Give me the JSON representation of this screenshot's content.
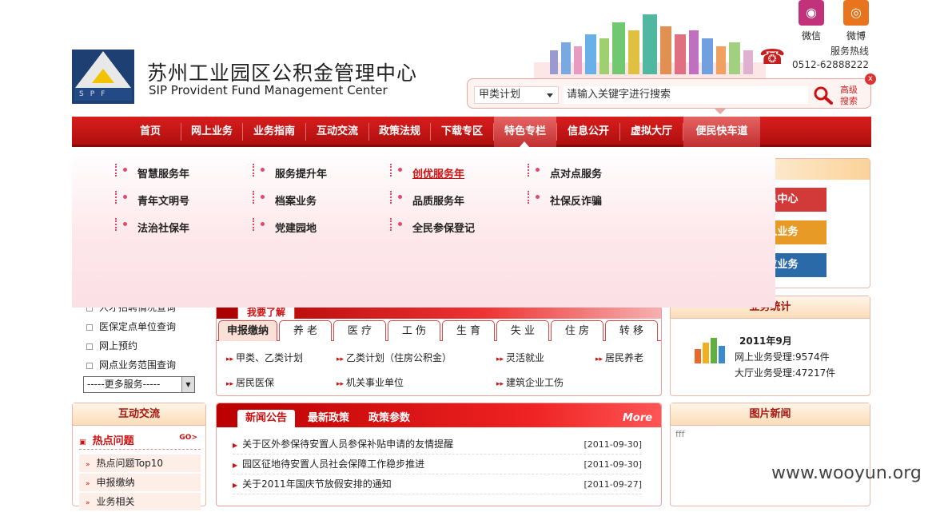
{
  "header": {
    "org_cn": "苏州工业园区公积金管理中心",
    "org_en": "SIP Provident Fund Management Center",
    "logo_text": "SPF",
    "wechat_label": "微信",
    "weibo_label": "微博",
    "hotline_label": "服务热线",
    "hotline_number": "0512-62888222"
  },
  "search": {
    "category_selected": "甲类计划",
    "placeholder": "请输入关键字进行搜索",
    "advanced_label_1": "高级",
    "advanced_label_2": "搜索",
    "close_label": "x"
  },
  "nav": {
    "items": [
      "首页",
      "网上业务",
      "业务指南",
      "互动交流",
      "政策法规",
      "下载专区",
      "特色专栏",
      "信息公开",
      "虚拟大厅",
      "便民快车道"
    ]
  },
  "dropdown": {
    "col1": [
      "智慧服务年",
      "青年文明号",
      "法治社保年"
    ],
    "col2": [
      "服务提升年",
      "档案业务",
      "党建园地"
    ],
    "col3": [
      "创优服务年",
      "品质服务年",
      "全民参保登记"
    ],
    "col4": [
      "点对点服务",
      "社保反诈骗"
    ]
  },
  "right": {
    "btn1": "息中心",
    "btn2": "人业务",
    "btn3": "位业务",
    "stats_title": "业务统计",
    "stats_month": "2011年9月",
    "stats_online": "网上业务受理:9574件",
    "stats_hall": "大厅业务受理:47217件",
    "pic_title": "图片新闻",
    "pic_text": "fff"
  },
  "want": {
    "title": "我要了解",
    "tabs": [
      "申报缴纳",
      "养 老",
      "医 疗",
      "工 伤",
      "生 育",
      "失 业",
      "住 房",
      "转 移"
    ],
    "links_row1": [
      "甲类、乙类计划",
      "乙类计划（住房公积金）",
      "灵活就业",
      "居民养老"
    ],
    "links_row2": [
      "居民医保",
      "机关事业单位",
      "建筑企业工伤"
    ]
  },
  "news": {
    "tabs": [
      "新闻公告",
      "最新政策",
      "政策参数"
    ],
    "more": "More",
    "items": [
      {
        "title": "关于区外参保待安置人员参保补贴申请的友情提醒",
        "date": "[2011-09-30]"
      },
      {
        "title": "园区征地待安置人员社会保障工作稳步推进",
        "date": "[2011-09-30]"
      },
      {
        "title": "关于2011年国庆节放假安排的通知",
        "date": "[2011-09-27]"
      }
    ]
  },
  "left": {
    "services": [
      "人才招聘情况查询",
      "医保定点单位查询",
      "网上预约",
      "网点业务范围查询"
    ],
    "more_select": "-----更多服务-----",
    "interact_title": "互动交流",
    "hot_title": "热点问题",
    "hot_go": "GO>",
    "hot_items": [
      "热点问题Top10",
      "申报缴纳",
      "业务相关"
    ]
  },
  "watermark": "www.wooyun.org",
  "colors": {
    "brand_red": "#c11",
    "nav_red": "#d81d1d",
    "dropdown_bg": "#fde6ea"
  }
}
